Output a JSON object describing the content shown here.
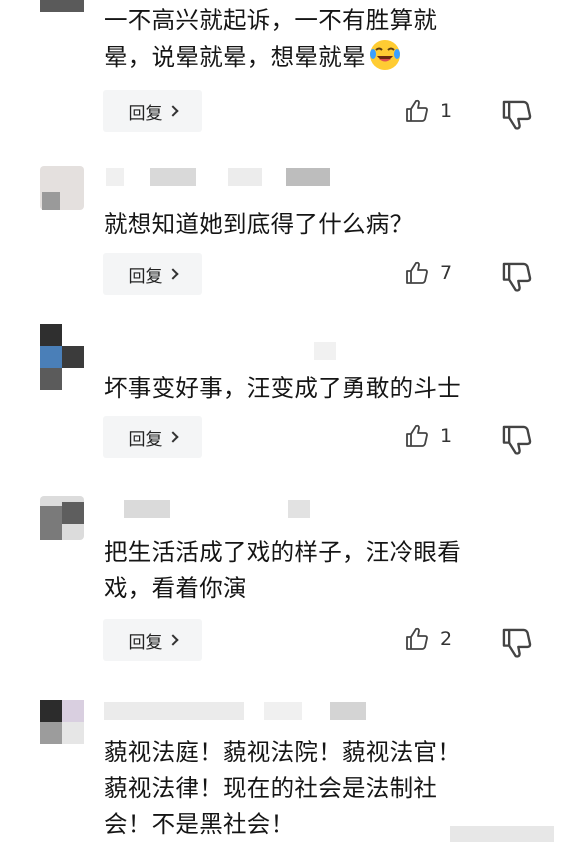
{
  "comments": [
    {
      "text_line1": "一不高兴就起诉，一不有胜算就",
      "text_line2": "晕，说晕就晕，想晕就晕",
      "emoji": "crying-laughing-emoji",
      "reply_label": "回复",
      "likes": "1"
    },
    {
      "text_line1": "就想知道她到底得了什么病？",
      "reply_label": "回复",
      "likes": "7"
    },
    {
      "text_line1": "坏事变好事，汪变成了勇敢的斗士",
      "reply_label": "回复",
      "likes": "1"
    },
    {
      "text_line1": "把生活活成了戏的样子，汪冷眼看",
      "text_line2": "戏，看着你演",
      "reply_label": "回复",
      "likes": "2"
    },
    {
      "text_line1": "藐视法庭！藐视法院！藐视法官！",
      "text_line2": "藐视法律！现在的社会是法制社",
      "text_line3": "会！不是黑社会！"
    }
  ],
  "icons": {
    "like": "thumbs-up-icon",
    "dislike": "thumbs-down-icon",
    "chevron": "chevron-right-icon"
  },
  "colors": {
    "reply_bg": "#f4f5f6",
    "text": "#151515",
    "icon": "#444444"
  }
}
